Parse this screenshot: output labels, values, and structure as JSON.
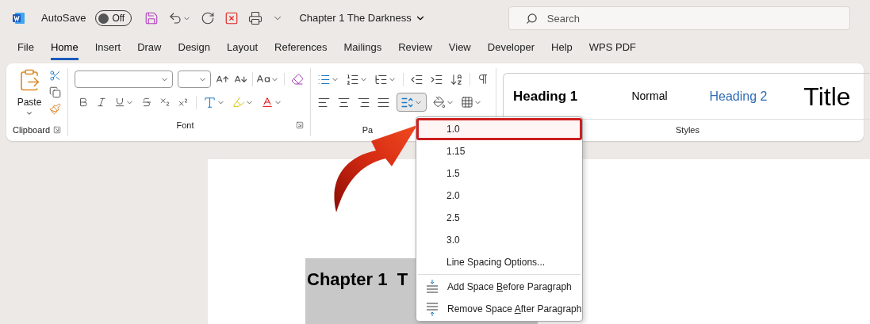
{
  "title_bar": {
    "autosave": {
      "label": "AutoSave",
      "on": false,
      "state_text": "Off"
    },
    "document_title": "Chapter 1 The Darkness",
    "search": {
      "placeholder": "Search"
    }
  },
  "tabs": [
    {
      "label": "File",
      "selected": false
    },
    {
      "label": "Home",
      "selected": true
    },
    {
      "label": "Insert",
      "selected": false
    },
    {
      "label": "Draw",
      "selected": false
    },
    {
      "label": "Design",
      "selected": false
    },
    {
      "label": "Layout",
      "selected": false
    },
    {
      "label": "References",
      "selected": false
    },
    {
      "label": "Mailings",
      "selected": false
    },
    {
      "label": "Review",
      "selected": false
    },
    {
      "label": "View",
      "selected": false
    },
    {
      "label": "Developer",
      "selected": false
    },
    {
      "label": "Help",
      "selected": false
    },
    {
      "label": "WPS PDF",
      "selected": false
    }
  ],
  "ribbon": {
    "clipboard": {
      "paste_label": "Paste",
      "group_label": "Clipboard"
    },
    "font": {
      "group_label": "Font"
    },
    "paragraph": {
      "group_label": "Pa"
    },
    "styles": {
      "group_label": "Styles",
      "items": [
        {
          "label": "Heading 1",
          "kind": "heading1"
        },
        {
          "label": "Normal",
          "kind": "normal"
        },
        {
          "label": "Heading 2",
          "kind": "heading2"
        },
        {
          "label": "Title",
          "kind": "title"
        }
      ]
    }
  },
  "line_spacing_menu": {
    "items": [
      {
        "label": "1.0",
        "selected": true
      },
      {
        "label": "1.15",
        "selected": false
      },
      {
        "label": "1.5",
        "selected": false
      },
      {
        "label": "2.0",
        "selected": false
      },
      {
        "label": "2.5",
        "selected": false
      },
      {
        "label": "3.0",
        "selected": false
      },
      {
        "label": "Line Spacing Options...",
        "selected": false
      }
    ],
    "actions": [
      {
        "text_before": "Add Space ",
        "access_key": "B",
        "text_after": "efore Paragraph"
      },
      {
        "text_before": "Remove Space ",
        "access_key": "A",
        "text_after": "fter Paragraph"
      }
    ]
  },
  "document": {
    "heading": "Chapter 1  T"
  }
}
